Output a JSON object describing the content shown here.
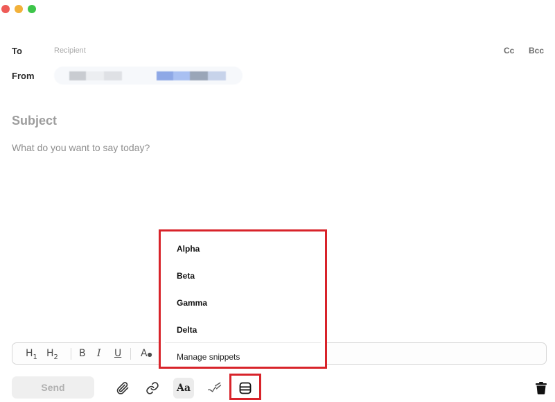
{
  "window": {
    "traffic_lights": [
      "close",
      "minimize",
      "zoom"
    ]
  },
  "header": {
    "to_label": "To",
    "recipient_placeholder": "Recipient",
    "cc_label": "Cc",
    "bcc_label": "Bcc",
    "from_label": "From"
  },
  "compose": {
    "subject_placeholder": "Subject",
    "body_placeholder": "What do you want to say today?"
  },
  "format_toolbar": {
    "h1": "H",
    "h1_sub": "1",
    "h2": "H",
    "h2_sub": "2",
    "bold": "B",
    "italic": "I",
    "underline": "U",
    "text_color": "A"
  },
  "snippets_menu": {
    "items": [
      "Alpha",
      "Beta",
      "Gamma",
      "Delta"
    ],
    "manage_label": "Manage snippets"
  },
  "bottom_bar": {
    "send_label": "Send",
    "format_toggle_label": "Aa",
    "icons": [
      "paperclip-icon",
      "link-icon",
      "text-format-icon",
      "signature-icon",
      "snippets-icon",
      "trash-icon"
    ]
  },
  "colors": {
    "highlight": "#d8232a",
    "send_bg": "#efefef"
  }
}
